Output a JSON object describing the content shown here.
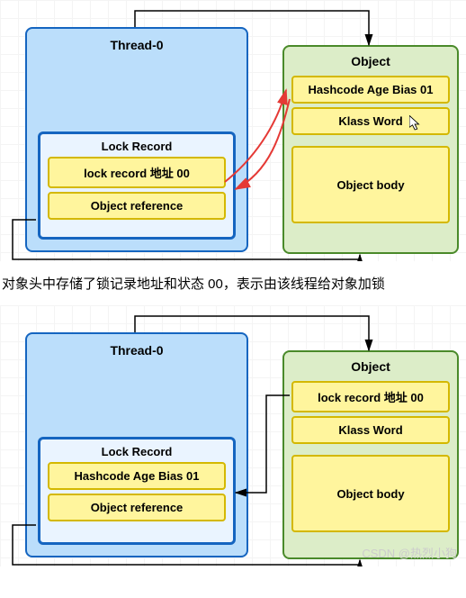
{
  "diagram1": {
    "thread": {
      "title": "Thread-0",
      "lockRecord": {
        "title": "Lock Record",
        "slot1": "lock record 地址 00",
        "slot2": "Object reference"
      }
    },
    "object": {
      "title": "Object",
      "row1": "Hashcode Age Bias 01",
      "row2": "Klass Word",
      "body": "Object body"
    }
  },
  "caption": "对象头中存储了锁记录地址和状态 00，表示由该线程给对象加锁",
  "diagram2": {
    "thread": {
      "title": "Thread-0",
      "lockRecord": {
        "title": "Lock Record",
        "slot1": "Hashcode Age Bias 01",
        "slot2": "Object reference"
      }
    },
    "object": {
      "title": "Object",
      "row1": "lock record 地址 00",
      "row2": "Klass Word",
      "body": "Object body"
    }
  },
  "watermark": "CSDN @热烈小狗"
}
